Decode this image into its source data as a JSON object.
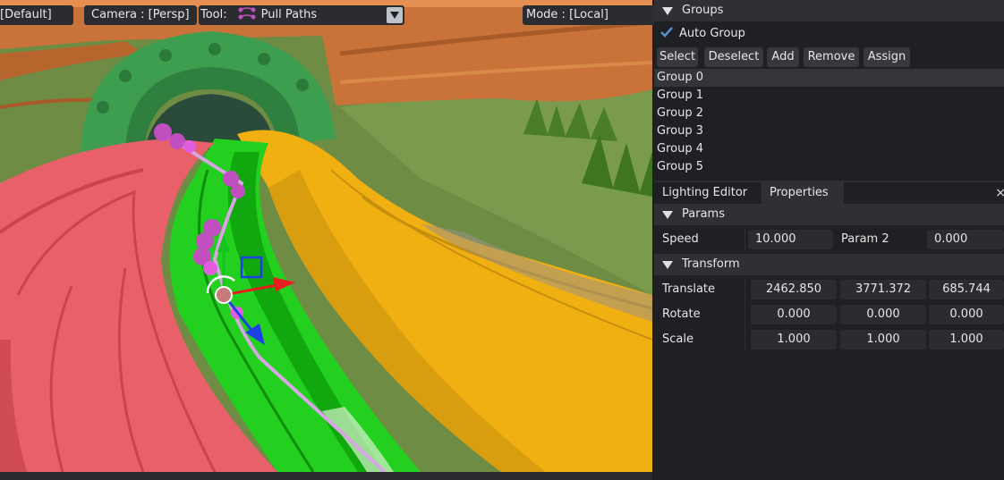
{
  "toolbar": {
    "view_label": "[Default]",
    "camera_label": "Camera : [Persp]",
    "tool_prefix": "Tool:",
    "tool_value": "Pull Paths",
    "mode_label": "Mode : [Local]"
  },
  "groups": {
    "title": "Groups",
    "auto_group_label": "Auto Group",
    "auto_group_checked": true,
    "buttons": [
      "Select",
      "Deselect",
      "Add",
      "Remove",
      "Assign"
    ],
    "items": [
      "Group 0",
      "Group 1",
      "Group 2",
      "Group 3",
      "Group 4",
      "Group 5"
    ],
    "selected_index": 0
  },
  "tabs": [
    "Lighting Editor",
    "Properties"
  ],
  "tab_close": "×",
  "params": {
    "title": "Params",
    "speed_label": "Speed",
    "speed_value": "10.000",
    "param2_label": "Param 2",
    "param2_value": "0.000"
  },
  "transform": {
    "title": "Transform",
    "translate_label": "Translate",
    "translate": [
      "2462.850",
      "3771.372",
      "685.744"
    ],
    "rotate_label": "Rotate",
    "rotate": [
      "0.000",
      "0.000",
      "0.000"
    ],
    "scale_label": "Scale",
    "scale": [
      "1.000",
      "1.000",
      "1.000"
    ]
  },
  "colors": {
    "panel_bg": "#1f2023",
    "header_bg": "#2e3034",
    "field_bg": "#2a2c30",
    "accent_check": "#5a8fd0",
    "track_red": "#e8606a",
    "track_green": "#22d21e",
    "track_yellow": "#f2b10e",
    "pipe_green": "#3a9b4c"
  },
  "icons": [
    "pull-paths-icon",
    "checkmark-icon",
    "dropdown-arrow-icon",
    "collapse-triangle-icon",
    "close-icon"
  ]
}
